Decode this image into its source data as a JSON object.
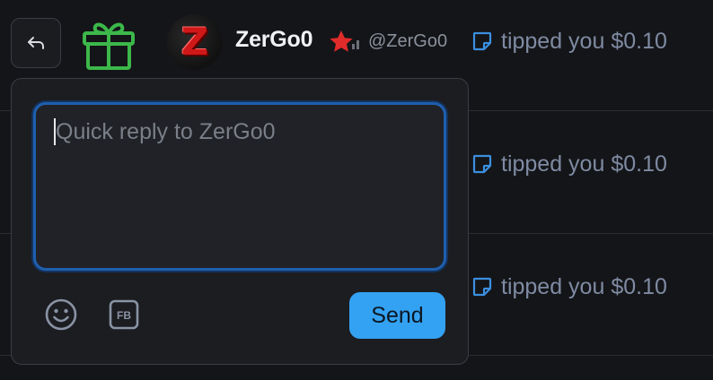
{
  "notification": {
    "username": "ZerGo0",
    "handle": "@ZerGo0",
    "avatar_letter": "Z"
  },
  "tips": [
    {
      "text": "tipped you $0.10"
    },
    {
      "text": "tipped you $0.10"
    },
    {
      "text": "tipped you $0.10"
    }
  ],
  "quick_reply": {
    "placeholder": "Quick reply to ZerGo0",
    "value": "",
    "send_label": "Send",
    "fb_label": "FB"
  },
  "icons": {
    "reply": "reply-arrow-icon",
    "gift": "gift-icon",
    "star_badge": "star-badge-icon",
    "tip": "note-icon",
    "emoji": "emoji-icon",
    "fb": "fb-emote-icon"
  },
  "colors": {
    "background": "#141518",
    "popup_background": "#1c1d21",
    "accent_blue": "#33a2f2",
    "gift_green": "#3cb84a",
    "star_red": "#e02b2b",
    "muted_text": "#7f8ba3"
  }
}
